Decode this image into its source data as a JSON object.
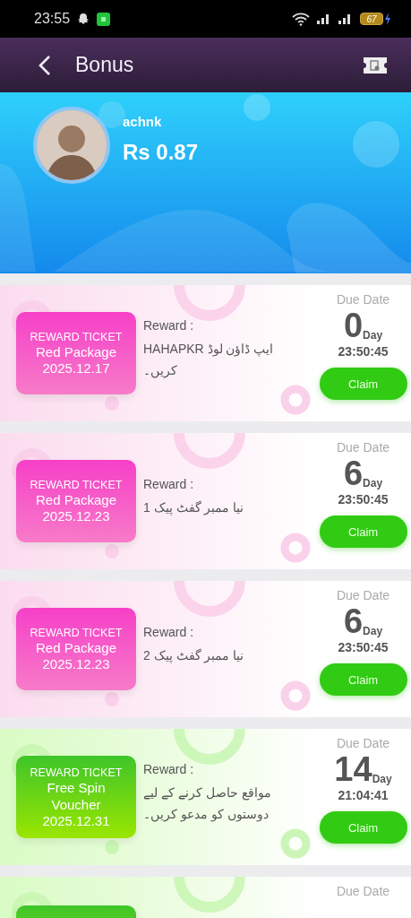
{
  "status_bar": {
    "time": "23:55",
    "battery": "67"
  },
  "header": {
    "title": "Bonus"
  },
  "profile": {
    "name": "achnk",
    "balance": "Rs 0.87"
  },
  "tickets": [
    {
      "kind": "red",
      "label": "REWARD TICKET",
      "title": "Red Package",
      "date": "2025.12.17",
      "reward_label": "Reward :",
      "reward_text": "HAHAPKR ایپ ڈاؤن لوڈ کریں۔",
      "due_label": "Due Date",
      "days": "0",
      "day_unit": "Day",
      "time": "23:50:45",
      "claim": "Claim"
    },
    {
      "kind": "red",
      "label": "REWARD TICKET",
      "title": "Red Package",
      "date": "2025.12.23",
      "reward_label": "Reward :",
      "reward_text": "نیا ممبر گفٹ پیک 1",
      "due_label": "Due Date",
      "days": "6",
      "day_unit": "Day",
      "time": "23:50:45",
      "claim": "Claim"
    },
    {
      "kind": "red",
      "label": "REWARD TICKET",
      "title": "Red Package",
      "date": "2025.12.23",
      "reward_label": "Reward :",
      "reward_text": "نیا ممبر گفٹ پیک 2",
      "due_label": "Due Date",
      "days": "6",
      "day_unit": "Day",
      "time": "23:50:45",
      "claim": "Claim"
    },
    {
      "kind": "green",
      "label": "REWARD TICKET",
      "title": "Free Spin Voucher",
      "date": "2025.12.31",
      "reward_label": "Reward :",
      "reward_text": "مواقع حاصل کرنے کے لیے دوستوں کو مدعو کریں۔",
      "due_label": "Due Date",
      "days": "14",
      "day_unit": "Day",
      "time": "21:04:41",
      "claim": "Claim"
    },
    {
      "kind": "green",
      "partial": true,
      "due_label": "Due Date"
    }
  ]
}
